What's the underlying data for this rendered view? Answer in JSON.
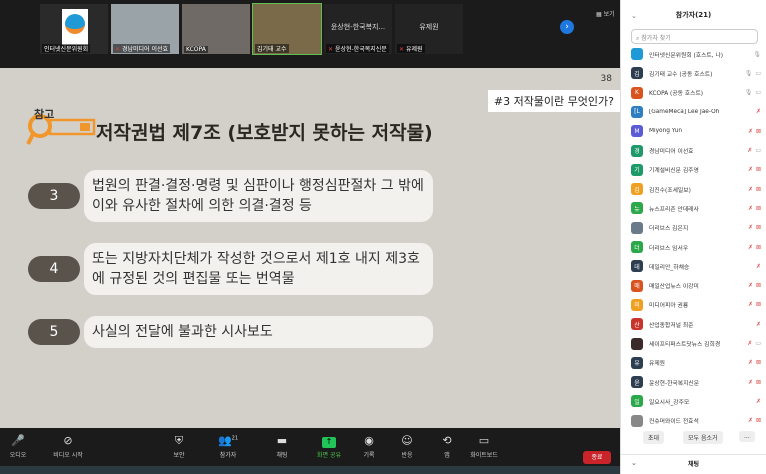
{
  "gallery": {
    "tiles": [
      {
        "name": "인터넷신문위원회",
        "muted": false,
        "logo": true
      },
      {
        "name": "경남미디어 이선효",
        "muted": true
      },
      {
        "name": "KCOPA",
        "muted": false
      },
      {
        "name": "김기태 교수",
        "muted": false,
        "active": true
      },
      {
        "name": "윤상현-한국복지신문",
        "muted": true,
        "label": "윤상현-한국복지..."
      },
      {
        "name": "유제원",
        "muted": true,
        "label": "유제원"
      }
    ],
    "view_label": "보기",
    "next_icon": "chevron-right-icon"
  },
  "slide": {
    "page": "38",
    "subtitle": "#3 저작물이란 무엇인가?",
    "ref_label": "참고",
    "title": "저작권법 제7조 (보호받지 못하는 저작물)",
    "accent": "#f0962a",
    "items": [
      {
        "num": "3",
        "text": "법원의 판결·결정·명령 및 심판이나 행정심판절차 그 밖에 이와 유사한 절차에 의한 의결·결정 등"
      },
      {
        "num": "4",
        "text": "또는 지방자치단체가 작성한 것으로서 제1호 내지 제3호에 규정된 것의 편집물 또는 번역물"
      },
      {
        "num": "5",
        "text": "사실의 전달에 불과한 시사보도"
      }
    ]
  },
  "toolbar": {
    "items": [
      {
        "label": "오디오",
        "icon": "microphone-icon"
      },
      {
        "label": "비디오 시작",
        "icon": "video-off-icon"
      },
      {
        "label": "보안",
        "icon": "shield-icon"
      },
      {
        "label": "참가자",
        "icon": "participants-icon",
        "count": "21"
      },
      {
        "label": "채팅",
        "icon": "chat-icon"
      },
      {
        "label": "화면 공유",
        "icon": "share-screen-icon"
      },
      {
        "label": "기록",
        "icon": "record-icon"
      },
      {
        "label": "반응",
        "icon": "reaction-icon"
      },
      {
        "label": "앱",
        "icon": "apps-icon"
      },
      {
        "label": "화이트보드",
        "icon": "whiteboard-icon"
      }
    ],
    "end_label": "종료"
  },
  "panel": {
    "title": "참가자(21)",
    "search_placeholder": "참가자 찾기",
    "participants": [
      {
        "name": "인터넷신문위원회 (호스트, 나)",
        "initial": "",
        "color": "#1f9ad6",
        "mic": "on",
        "video": "none"
      },
      {
        "name": "김기태 교수 (공동 호스트)",
        "initial": "김",
        "color": "#2d3e50",
        "mic": "on",
        "video": "on"
      },
      {
        "name": "KCOPA (공동 호스트)",
        "initial": "K",
        "color": "#d9531e",
        "mic": "on",
        "video": "on"
      },
      {
        "name": "[GameMeca] Lee Jae-Oh",
        "initial": "[L",
        "color": "#2d7fc1",
        "mic": "off",
        "video": "none"
      },
      {
        "name": "Miyong Yun",
        "initial": "M",
        "color": "#5b5bd6",
        "mic": "off",
        "video": "off"
      },
      {
        "name": "경남미디어 이선효",
        "initial": "경",
        "color": "#1e9a6a",
        "mic": "off",
        "video": "on"
      },
      {
        "name": "기계설비신문 김주영",
        "initial": "기",
        "color": "#1e9a6a",
        "mic": "off",
        "video": "off"
      },
      {
        "name": "김진수(조세일보)",
        "initial": "김",
        "color": "#f0a020",
        "mic": "off",
        "video": "off"
      },
      {
        "name": "뉴스프리존 안데레사",
        "initial": "뉴",
        "color": "#2aa84a",
        "mic": "off",
        "video": "off"
      },
      {
        "name": "더리브스 김은지",
        "initial": "",
        "color": "#6a7a8a",
        "mic": "off",
        "video": "off"
      },
      {
        "name": "더리브스 임서우",
        "initial": "더",
        "color": "#2aa84a",
        "mic": "off",
        "video": "off"
      },
      {
        "name": "데일리안_하채승",
        "initial": "데",
        "color": "#2d3e50",
        "mic": "off",
        "video": "none"
      },
      {
        "name": "매일산업뉴스 이강미",
        "initial": "매",
        "color": "#d9531e",
        "mic": "off",
        "video": "off"
      },
      {
        "name": "미디어피아 권룡",
        "initial": "미",
        "color": "#f0a020",
        "mic": "off",
        "video": "off"
      },
      {
        "name": "산업종합저널 최준",
        "initial": "산",
        "color": "#c8342a",
        "mic": "off",
        "video": "none"
      },
      {
        "name": "세이프티퍼스트닷뉴스 김희경",
        "initial": "",
        "color": "#3a2a2a",
        "mic": "off",
        "video": "on"
      },
      {
        "name": "유제원",
        "initial": "유",
        "color": "#2d3e50",
        "mic": "off",
        "video": "off"
      },
      {
        "name": "윤상현-한국복지신문",
        "initial": "윤",
        "color": "#2d3e50",
        "mic": "off",
        "video": "off"
      },
      {
        "name": "일요시사_강주모",
        "initial": "일",
        "color": "#2aa84a",
        "mic": "off",
        "video": "none"
      },
      {
        "name": "컨슈머와이드 전효석",
        "initial": "",
        "color": "#888",
        "mic": "off",
        "video": "off"
      }
    ],
    "invite_label": "초대",
    "mute_all_label": "모두 음소거",
    "more_label": "...",
    "chat_label": "채팅"
  }
}
